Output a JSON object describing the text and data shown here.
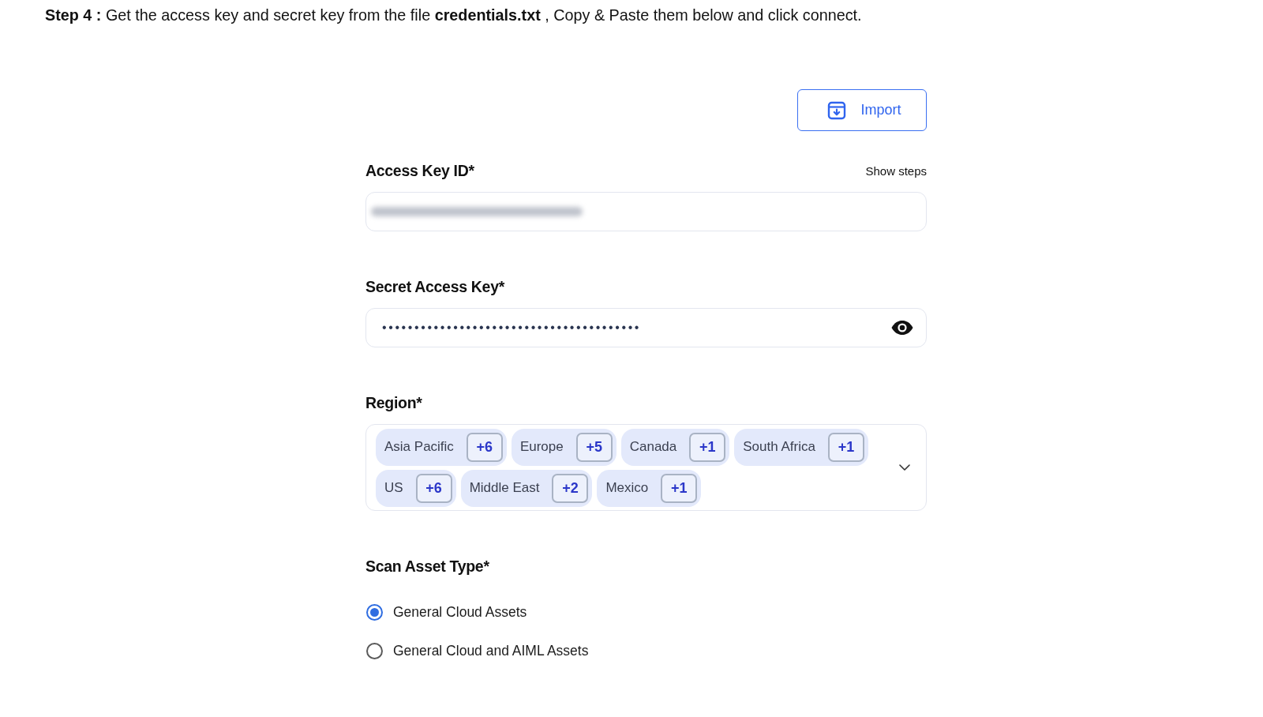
{
  "instruction": "**Step 4 :** Get the access key and secret key from the file **credentials.txt** , Copy & Paste them below and click connect.",
  "import_button": {
    "label": "Import"
  },
  "fields": [
    {
      "kind": "text",
      "label": "Access Key ID*",
      "link": "Show steps",
      "value_blurred": true
    },
    {
      "kind": "password",
      "label": "Secret Access Key*",
      "value": "••••••••••••••••••••••••••••••••••••••••"
    },
    {
      "kind": "multiselect",
      "label": "Region*",
      "chips": [
        {
          "label": "Asia Pacific",
          "count": "+6"
        },
        {
          "label": "Europe",
          "count": "+5"
        },
        {
          "label": "Canada",
          "count": "+1"
        },
        {
          "label": "South Africa",
          "count": "+1"
        },
        {
          "label": "US",
          "count": "+6"
        },
        {
          "label": "Middle East",
          "count": "+2"
        },
        {
          "label": "Mexico",
          "count": "+1"
        }
      ]
    },
    {
      "kind": "radio",
      "label": "Scan Asset Type*",
      "options": [
        {
          "label": "General Cloud Assets",
          "selected": true
        },
        {
          "label": "General Cloud and AIML Assets",
          "selected": false
        }
      ]
    }
  ]
}
